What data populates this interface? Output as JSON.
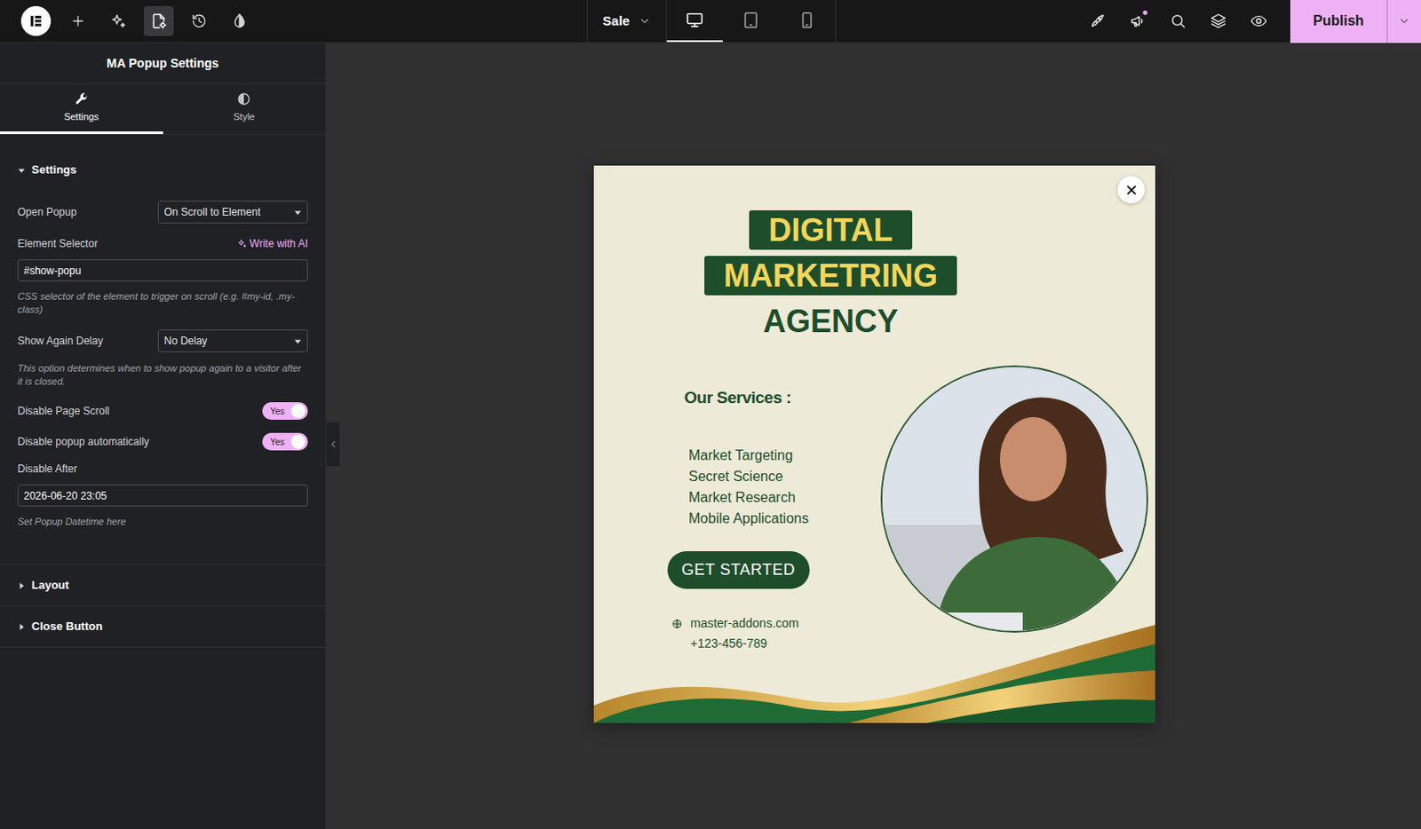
{
  "topbar": {
    "tools": [
      {
        "kind": "plus",
        "selected": false
      },
      {
        "kind": "ai",
        "selected": false
      },
      {
        "kind": "page-settings",
        "selected": true
      },
      {
        "kind": "history",
        "selected": false
      },
      {
        "kind": "theme",
        "selected": false
      }
    ],
    "page": "Sale",
    "devices": [
      {
        "kind": "desktop",
        "selected": true
      },
      {
        "kind": "tablet",
        "selected": false
      },
      {
        "kind": "mobile",
        "selected": false
      }
    ],
    "actions": [
      {
        "kind": "checklist",
        "unread": false
      },
      {
        "kind": "whats-new",
        "unread": true
      },
      {
        "kind": "finder",
        "unread": false
      },
      {
        "kind": "structure",
        "unread": false
      },
      {
        "kind": "preview",
        "unread": false
      }
    ],
    "publish": "Publish"
  },
  "sidebar": {
    "title": "MA Popup Settings",
    "tabs": [
      {
        "label": "Settings",
        "kind": "settings",
        "selected": true
      },
      {
        "label": "Style",
        "kind": "style",
        "selected": false
      }
    ],
    "sections": [
      {
        "title": "Settings",
        "expanded": true
      },
      {
        "title": "Layout",
        "expanded": false
      },
      {
        "title": "Close Button",
        "expanded": false
      }
    ],
    "fields": [
      {
        "kind": "select",
        "label": "Open Popup",
        "value": "On Scroll to Element"
      },
      {
        "kind": "input",
        "label": "Element Selector",
        "ai": "Write with AI",
        "value": "#show-popu",
        "help": "CSS selector of the element to trigger on scroll (e.g. #my-id, .my-class)"
      },
      {
        "kind": "select",
        "label": "Show Again Delay",
        "value": "No Delay",
        "help": "This option determines when to show popup again to a visitor after it is closed."
      },
      {
        "kind": "toggle",
        "label": "Disable Page Scroll",
        "on": true,
        "text": "Yes"
      },
      {
        "kind": "toggle",
        "label": "Disable popup automatically",
        "on": true,
        "text": "Yes"
      },
      {
        "kind": "input",
        "label": "Disable After",
        "value": "2026-06-20 23:05",
        "help": "Set Popup Datetime here"
      }
    ]
  },
  "popup": {
    "heading": [
      {
        "text": "DIGITAL",
        "highlight": true
      },
      {
        "text": "MARKETRING",
        "highlight": true
      },
      {
        "text": "AGENCY",
        "highlight": false
      }
    ],
    "services_title": "Our Services :",
    "services": [
      "Market Targeting",
      "Secret Science",
      "Market Research",
      "Mobile Applications"
    ],
    "button": "GET STARTED",
    "contacts": [
      {
        "text": "master-addons.com",
        "kind": "web"
      },
      {
        "text": "+123-456-789",
        "kind": "plain"
      }
    ]
  }
}
